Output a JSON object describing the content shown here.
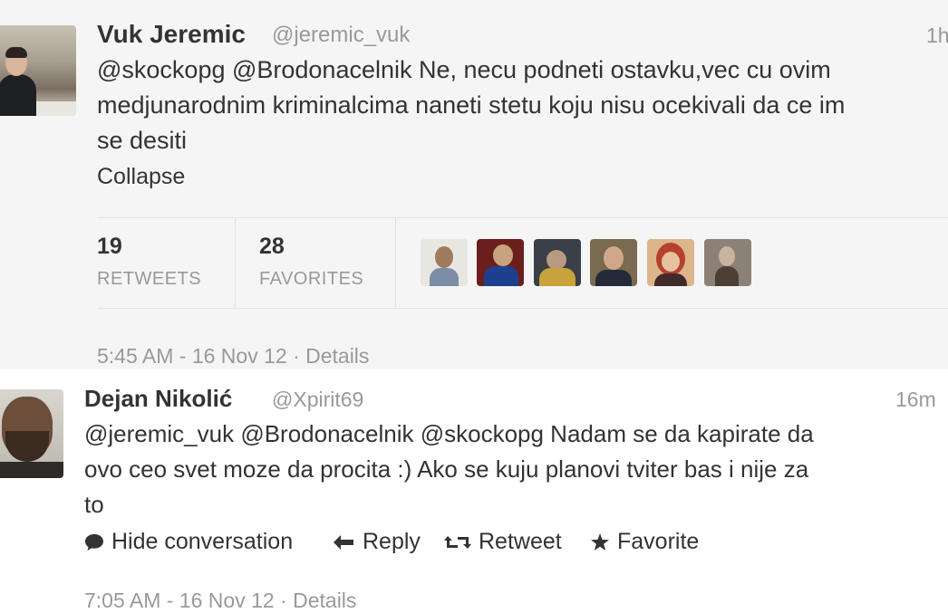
{
  "tweets": [
    {
      "name": "Vuk Jeremic",
      "handle": "@jeremic_vuk",
      "time": "1h",
      "text_lines": [
        "@skockopg @Brodonacelnik Ne, necu podneti ostavku,vec cu ovim",
        "medjunarodnim kriminalcima naneti stetu koju nisu ocekivali da ce im",
        "se desiti"
      ],
      "collapse_label": "Collapse",
      "retweets": {
        "count": "19",
        "label": "RETWEETS"
      },
      "favorites": {
        "count": "28",
        "label": "FAVORITES"
      },
      "timestamp": "5:45 AM - 16 Nov 12 · Details"
    },
    {
      "name": "Dejan Nikolić",
      "handle": "@Xpirit69",
      "time": "16m",
      "text_lines": [
        "@jeremic_vuk @Brodonacelnik @skockopg Nadam se da kapirate da",
        "ovo ceo svet moze da procita :) Ako se kuju planovi tviter bas i nije za",
        "to"
      ],
      "actions": {
        "hide": "Hide conversation",
        "reply": "Reply",
        "retweet": "Retweet",
        "favorite": "Favorite"
      },
      "timestamp": "7:05 AM - 16 Nov 12 · Details"
    }
  ],
  "icons": {
    "hide": "speech-bubble-icon",
    "reply": "reply-arrow-icon",
    "retweet": "retweet-icon",
    "favorite": "star-icon"
  },
  "colors": {
    "text": "#333333",
    "muted": "#999999",
    "first_tweet_bg": "#f5f5f5",
    "second_tweet_bg": "#ffffff"
  }
}
